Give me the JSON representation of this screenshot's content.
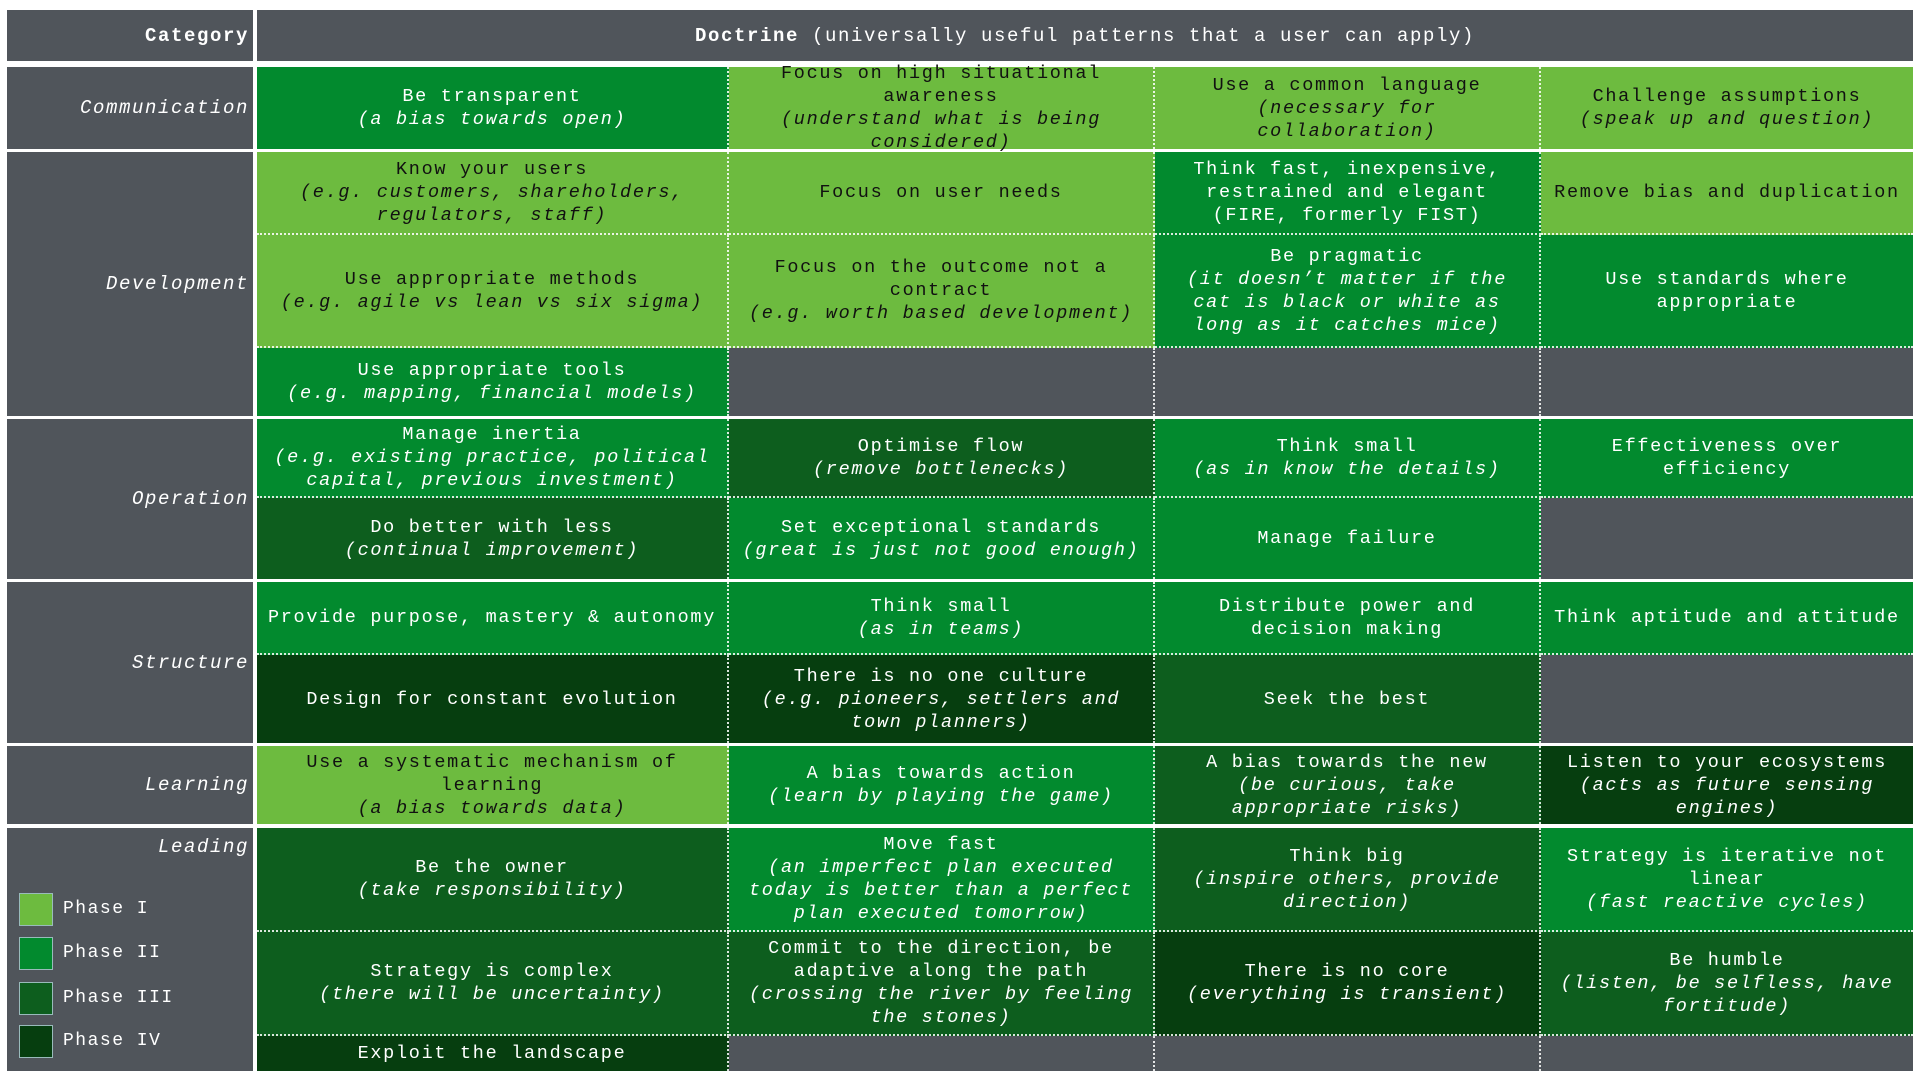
{
  "header": {
    "category_label": "Category",
    "doctrine_label": "Doctrine",
    "doctrine_desc": " (universally useful patterns that a user can apply)"
  },
  "phase_colors": {
    "1": "#6dbb3f",
    "2": "#028a2e",
    "3": "#0d5e1e",
    "4": "#063e0f"
  },
  "legend": [
    {
      "label": "Phase I",
      "phase": 1
    },
    {
      "label": "Phase II",
      "phase": 2
    },
    {
      "label": "Phase III",
      "phase": 3
    },
    {
      "label": "Phase IV",
      "phase": 4
    }
  ],
  "categories": [
    {
      "name": "Communication",
      "rows": [
        [
          {
            "title": "Be transparent",
            "note": "(a bias towards open)",
            "phase": 2
          },
          {
            "title": "Focus on high situational awareness",
            "note": "(understand what is being considered)",
            "phase": 1
          },
          {
            "title": "Use a common language",
            "note": "(necessary for collaboration)",
            "phase": 1
          },
          {
            "title": "Challenge assumptions",
            "note": "(speak up and question)",
            "phase": 1
          }
        ]
      ]
    },
    {
      "name": "Development",
      "rows": [
        [
          {
            "title": "Know your users",
            "note": "(e.g. customers, shareholders, regulators, staff)",
            "phase": 1
          },
          {
            "title": "Focus on user needs",
            "note": "",
            "phase": 1
          },
          {
            "title": "Think fast, inexpensive, restrained and elegant (FIRE, formerly FIST)",
            "note": "",
            "phase": 2
          },
          {
            "title": "Remove bias and duplication",
            "note": "",
            "phase": 1
          }
        ],
        [
          {
            "title": "Use appropriate methods",
            "note": "(e.g. agile vs lean vs six sigma)",
            "phase": 1
          },
          {
            "title": "Focus on the outcome not a contract",
            "note": "(e.g. worth based development)",
            "phase": 1
          },
          {
            "title": "Be pragmatic",
            "note": "(it doesn’t matter if the cat is black or white as long as it catches mice)",
            "phase": 2
          },
          {
            "title": "Use standards where appropriate",
            "note": "",
            "phase": 2
          }
        ],
        [
          {
            "title": "Use appropriate tools",
            "note": "(e.g. mapping, financial models)",
            "phase": 2
          },
          null,
          null,
          null
        ]
      ]
    },
    {
      "name": "Operation",
      "rows": [
        [
          {
            "title": "Manage inertia",
            "note": "(e.g. existing practice, political capital, previous investment)",
            "phase": 2
          },
          {
            "title": "Optimise flow",
            "note": "(remove bottlenecks)",
            "phase": 3
          },
          {
            "title": "Think small",
            "note": "(as in know the details)",
            "phase": 2
          },
          {
            "title": "Effectiveness over efficiency",
            "note": "",
            "phase": 2
          }
        ],
        [
          {
            "title": "Do better with less",
            "note": "(continual improvement)",
            "phase": 3
          },
          {
            "title": "Set exceptional standards",
            "note": "(great is just not good enough)",
            "phase": 2
          },
          {
            "title": "Manage failure",
            "note": "",
            "phase": 2
          },
          null
        ]
      ]
    },
    {
      "name": "Structure",
      "rows": [
        [
          {
            "title": "Provide purpose, mastery & autonomy",
            "note": "",
            "phase": 2
          },
          {
            "title": "Think small",
            "note": "(as in teams)",
            "phase": 2
          },
          {
            "title": "Distribute power and decision making",
            "note": "",
            "phase": 2
          },
          {
            "title": "Think aptitude and attitude",
            "note": "",
            "phase": 2
          }
        ],
        [
          {
            "title": "Design for constant evolution",
            "note": "",
            "phase": 4
          },
          {
            "title": "There is no one culture",
            "note": "(e.g. pioneers, settlers and town planners)",
            "phase": 4
          },
          {
            "title": "Seek the best",
            "note": "",
            "phase": 3
          },
          null
        ]
      ]
    },
    {
      "name": "Learning",
      "rows": [
        [
          {
            "title": "Use a systematic mechanism of learning",
            "note": "(a bias towards data)",
            "phase": 1
          },
          {
            "title": "A bias towards action",
            "note": "(learn by playing the game)",
            "phase": 2
          },
          {
            "title": "A bias towards the new",
            "note": "(be curious, take appropriate risks)",
            "phase": 3
          },
          {
            "title": "Listen to your ecosystems",
            "note": "(acts as future sensing engines)",
            "phase": 4
          }
        ]
      ]
    },
    {
      "name": "Leading",
      "rows": [
        [
          {
            "title": "Be the owner",
            "note": "(take responsibility)",
            "phase": 3
          },
          {
            "title": "Move fast",
            "note": "(an imperfect plan executed today is better than a perfect plan executed tomorrow)",
            "phase": 2
          },
          {
            "title": "Think big",
            "note": "(inspire others, provide direction)",
            "phase": 3
          },
          {
            "title": "Strategy is iterative not linear",
            "note": "(fast reactive cycles)",
            "phase": 2
          }
        ],
        [
          {
            "title": "Strategy is complex",
            "note": "(there will be uncertainty)",
            "phase": 3
          },
          {
            "title": "Commit to the direction, be adaptive along the path",
            "note": "(crossing the river by feeling the stones)",
            "phase": 3
          },
          {
            "title": "There is no core",
            "note": "(everything is transient)",
            "phase": 4
          },
          {
            "title": "Be humble",
            "note": "(listen, be selfless, have fortitude)",
            "phase": 3
          }
        ],
        [
          {
            "title": "Exploit the landscape",
            "note": "",
            "phase": 4
          },
          null,
          null,
          null
        ]
      ]
    }
  ]
}
